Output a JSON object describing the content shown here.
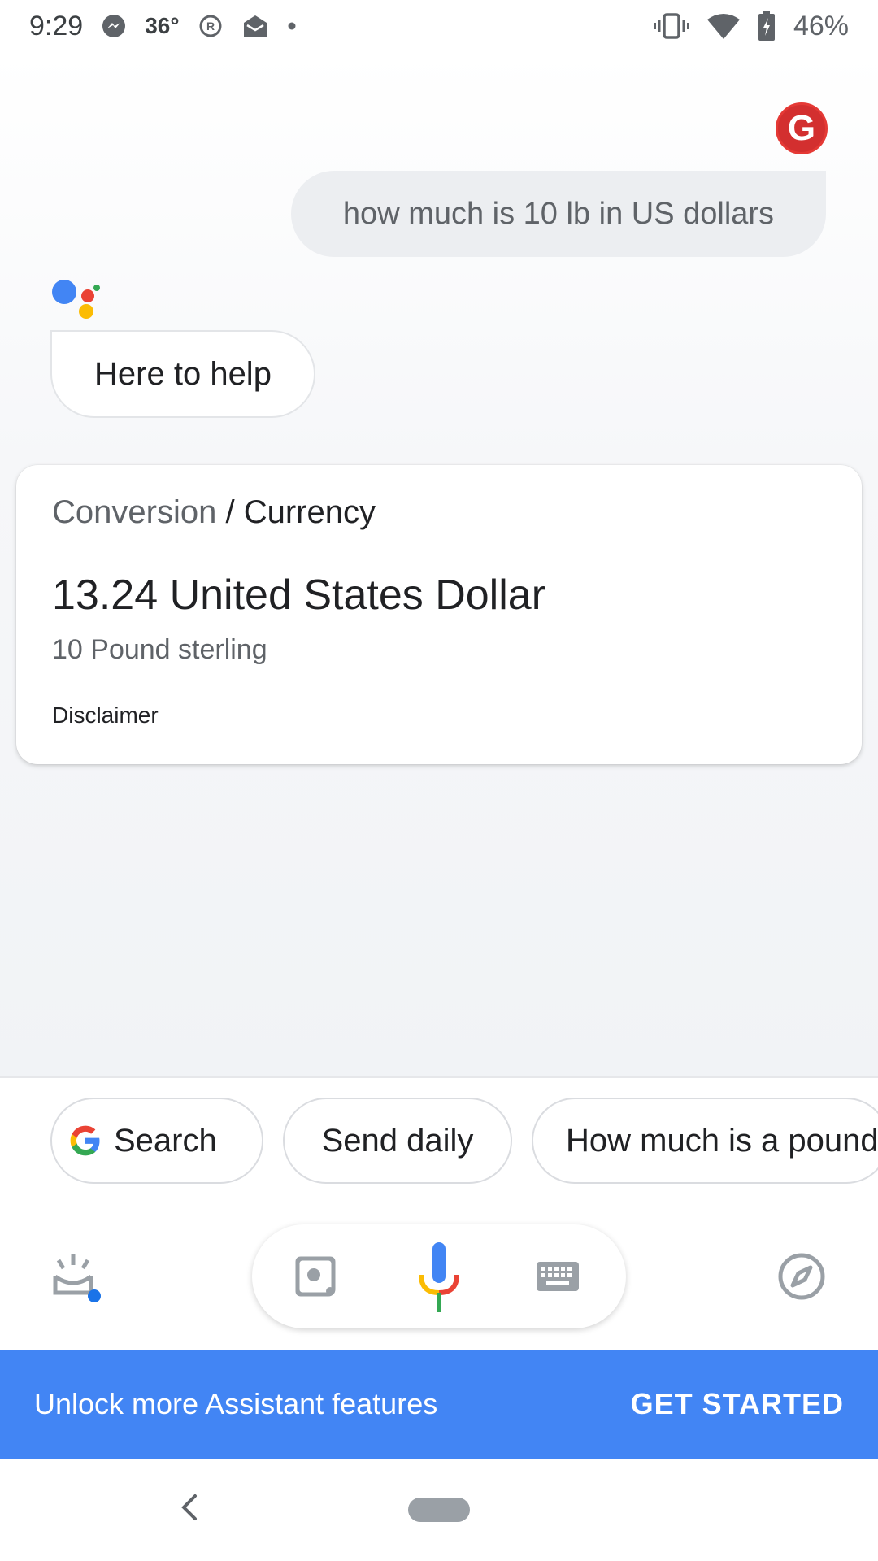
{
  "status_bar": {
    "time": "9:29",
    "temperature": "36°",
    "battery": "46%",
    "icons": [
      "messenger-icon",
      "registered-icon",
      "mail-icon",
      "dot-icon",
      "vibrate-icon",
      "wifi-icon",
      "battery-icon"
    ]
  },
  "conversation": {
    "user_avatar_letter": "G",
    "user_query": "how much is 10 lb in US dollars",
    "assistant_reply": "Here to help"
  },
  "card": {
    "crumb_category": "Conversion",
    "crumb_separator": "/",
    "crumb_topic": "Currency",
    "result": "13.24 United States Dollar",
    "source": "10 Pound sterling",
    "disclaimer": "Disclaimer"
  },
  "suggestions": [
    {
      "label": "Search"
    },
    {
      "label": "Send daily"
    },
    {
      "label": "How much is a pound"
    }
  ],
  "actions": {
    "icons": [
      "updates-icon",
      "lens-icon",
      "mic-icon",
      "keyboard-icon",
      "explore-icon"
    ]
  },
  "banner": {
    "text": "Unlock more Assistant features",
    "button": "GET STARTED"
  },
  "colors": {
    "accent": "#4285f4",
    "google_red": "#ea4335",
    "google_yellow": "#fbbc04",
    "google_green": "#34a853",
    "avatar": "#d32f2f"
  }
}
